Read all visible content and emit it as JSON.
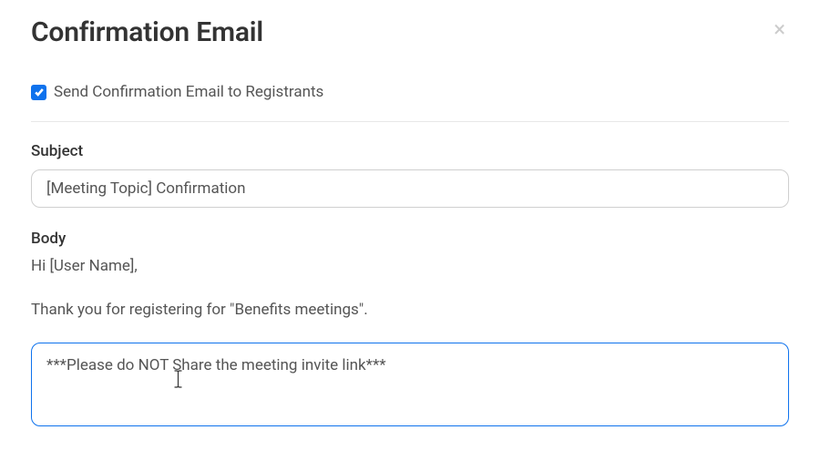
{
  "modal": {
    "title": "Confirmation Email",
    "close_label": "×"
  },
  "checkbox": {
    "label": "Send Confirmation Email to Registrants",
    "checked": true
  },
  "subject": {
    "label": "Subject",
    "value": "[Meeting Topic] Confirmation"
  },
  "body": {
    "label": "Body",
    "greeting": "Hi [User Name],",
    "intro": "Thank you for registering for \"Benefits meetings\".",
    "custom_text": "***Please do NOT Share the meeting invite link***"
  }
}
